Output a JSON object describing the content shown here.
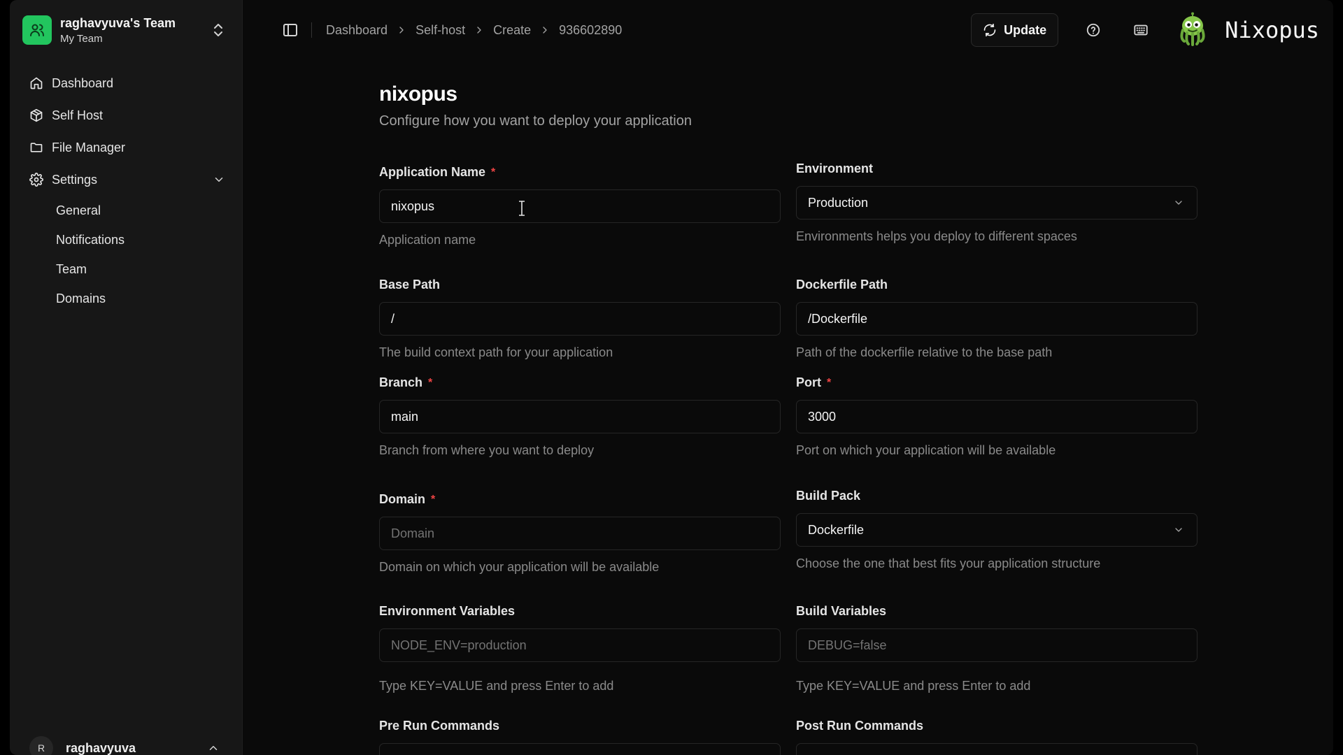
{
  "sidebar": {
    "team": {
      "name": "raghavyuva's Team",
      "subtitle": "My Team"
    },
    "nav": [
      {
        "label": "Dashboard",
        "icon": "home-icon"
      },
      {
        "label": "Self Host",
        "icon": "package-icon"
      },
      {
        "label": "File Manager",
        "icon": "folder-icon"
      },
      {
        "label": "Settings",
        "icon": "gear-icon"
      }
    ],
    "settings_sub": [
      "General",
      "Notifications",
      "Team",
      "Domains"
    ],
    "user": {
      "initial": "R",
      "name": "raghavyuva"
    }
  },
  "topbar": {
    "breadcrumbs": [
      "Dashboard",
      "Self-host",
      "Create",
      "936602890"
    ],
    "update_label": "Update",
    "brand": "Nixopus"
  },
  "form": {
    "title": "nixopus",
    "subtitle": "Configure how you want to deploy your application",
    "application_name": {
      "label": "Application Name",
      "value": "nixopus",
      "help": "Application name"
    },
    "environment": {
      "label": "Environment",
      "value": "Production",
      "help": "Environments helps you deploy to different spaces"
    },
    "base_path": {
      "label": "Base Path",
      "value": "/",
      "help": "The build context path for your application"
    },
    "dockerfile_path": {
      "label": "Dockerfile Path",
      "value": "/Dockerfile",
      "help": "Path of the dockerfile relative to the base path"
    },
    "branch": {
      "label": "Branch",
      "value": "main",
      "help": "Branch from where you want to deploy"
    },
    "port": {
      "label": "Port",
      "value": "3000",
      "help": "Port on which your application will be available"
    },
    "domain": {
      "label": "Domain",
      "placeholder": "Domain",
      "help": "Domain on which your application will be available"
    },
    "build_pack": {
      "label": "Build Pack",
      "value": "Dockerfile",
      "help": "Choose the one that best fits your application structure"
    },
    "env_vars": {
      "label": "Environment Variables",
      "placeholder": "NODE_ENV=production",
      "help": "Type KEY=VALUE and press Enter to add"
    },
    "build_vars": {
      "label": "Build Variables",
      "placeholder": "DEBUG=false",
      "help": "Type KEY=VALUE and press Enter to add"
    },
    "pre_run": {
      "label": "Pre Run Commands"
    },
    "post_run": {
      "label": "Post Run Commands"
    },
    "required_mark": "*"
  },
  "colors": {
    "accent": "#22c55e",
    "required": "#ef4444",
    "background": "#0a0a0a",
    "sidebar": "#171717"
  }
}
